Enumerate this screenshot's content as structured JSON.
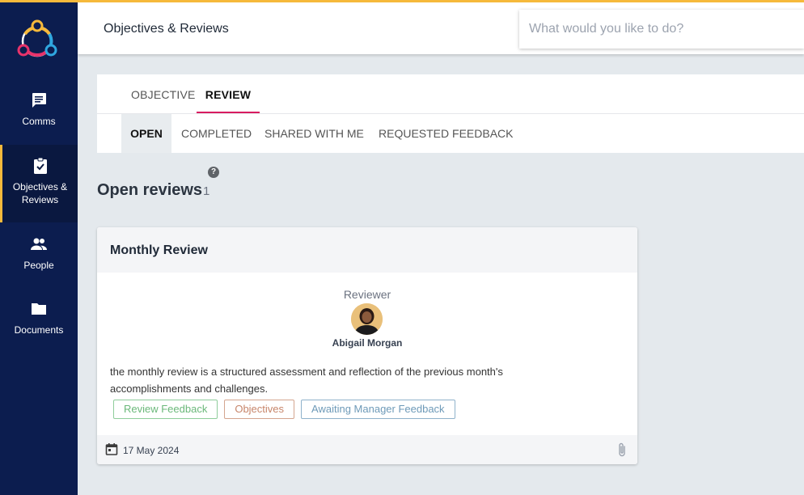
{
  "sidebar": {
    "items": [
      {
        "label": "Comms",
        "icon": "chat-icon"
      },
      {
        "label": "Objectives & Reviews",
        "icon": "clipboard-check-icon"
      },
      {
        "label": "People",
        "icon": "people-icon"
      },
      {
        "label": "Documents",
        "icon": "folder-icon"
      }
    ]
  },
  "header": {
    "title": "Objectives & Reviews",
    "search_placeholder": "What would you like to do?"
  },
  "tabs": {
    "main": [
      "OBJECTIVE",
      "REVIEW"
    ],
    "sub": [
      "OPEN",
      "COMPLETED",
      "SHARED WITH ME",
      "REQUESTED FEEDBACK"
    ]
  },
  "section": {
    "title": "Open reviews",
    "count": "1"
  },
  "card": {
    "title": "Monthly Review",
    "reviewer_label": "Reviewer",
    "reviewer_name": "Abigail Morgan",
    "description": "the monthly review is a structured assessment and reflection of the previous month's accomplishments and challenges.",
    "tags": [
      "Review Feedback",
      "Objectives",
      "Awaiting Manager Feedback"
    ],
    "date": "17 May 2024"
  },
  "colors": {
    "sidebar_bg": "#0c1d4f",
    "accent_yellow": "#f6b93b",
    "tab_underline": "#d81b60"
  }
}
